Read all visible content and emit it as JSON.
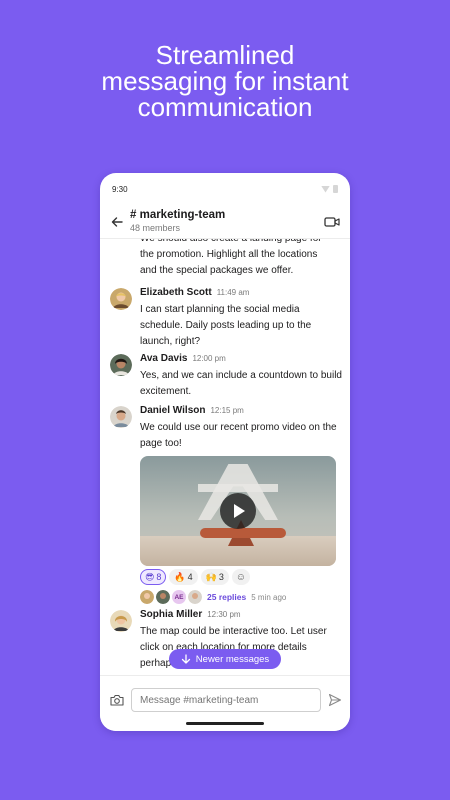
{
  "headline": [
    "Streamlined",
    "messaging for instant",
    "communication"
  ],
  "status_bar": {
    "time": "9:30"
  },
  "header": {
    "channel": "# marketing-team",
    "members": "48 members"
  },
  "messages": {
    "cont_text": "We should also create a landing page for the promotion. Highlight all the locations and the special packages we offer.",
    "items": [
      {
        "name": "Elizabeth Scott",
        "time": "11:49 am",
        "text": "I can start planning the social media schedule. Daily posts leading up to the launch, right?"
      },
      {
        "name": "Ava Davis",
        "time": "12:00 pm",
        "text": "Yes, and we can include a countdown to build excitement."
      },
      {
        "name": "Daniel Wilson",
        "time": "12:15 pm",
        "text": "We could use our recent promo video on the page too!"
      },
      {
        "name": "Sophia Miller",
        "time": "12:30 pm",
        "text": "The map could be interactive too. Let user click on each location for more details perhaps?"
      }
    ]
  },
  "reactions": [
    {
      "emoji": "😎",
      "count": "8"
    },
    {
      "emoji": "🔥",
      "count": "4"
    },
    {
      "emoji": "🙌",
      "count": "3"
    }
  ],
  "reaction_add_icon": "☺",
  "thread": {
    "initials": "AE",
    "replies": "25 replies",
    "time": "5 min ago"
  },
  "newer_messages": "Newer messages",
  "composer": {
    "placeholder": "Message #marketing-team"
  },
  "colors": {
    "brand": "#7b5cf0",
    "accent_text": "#6b4bdc"
  }
}
